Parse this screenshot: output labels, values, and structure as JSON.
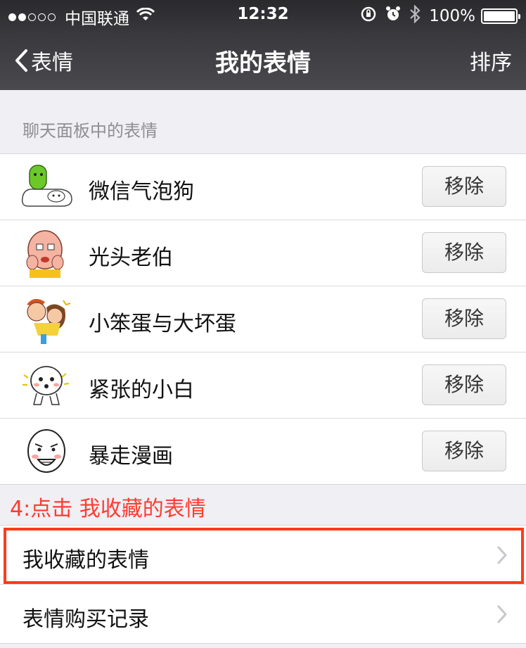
{
  "status_bar": {
    "carrier": "中国联通",
    "time": "12:32",
    "battery": "100%",
    "signal_bars_filled": 2,
    "signal_bars_total": 5
  },
  "nav": {
    "back_label": "表情",
    "title": "我的表情",
    "right_label": "排序"
  },
  "section": {
    "header": "聊天面板中的表情"
  },
  "stickers": [
    {
      "name": "微信气泡狗",
      "action": "移除",
      "icon": "bubble-dog-icon"
    },
    {
      "name": "光头老伯",
      "action": "移除",
      "icon": "bald-old-man-icon"
    },
    {
      "name": "小笨蛋与大坏蛋",
      "action": "移除",
      "icon": "silly-and-bad-egg-icon"
    },
    {
      "name": "紧张的小白",
      "action": "移除",
      "icon": "nervous-white-icon"
    },
    {
      "name": "暴走漫画",
      "action": "移除",
      "icon": "rage-comic-icon"
    }
  ],
  "annotation": "4:点击  我收藏的表情",
  "links": [
    {
      "label": "我收藏的表情",
      "icon": "chevron-right-icon"
    },
    {
      "label": "表情购买记录",
      "icon": "chevron-right-icon"
    }
  ],
  "colors": {
    "annotation": "#ff3b30",
    "highlight_border": "#ff3b1a",
    "background": "#efeff4"
  }
}
